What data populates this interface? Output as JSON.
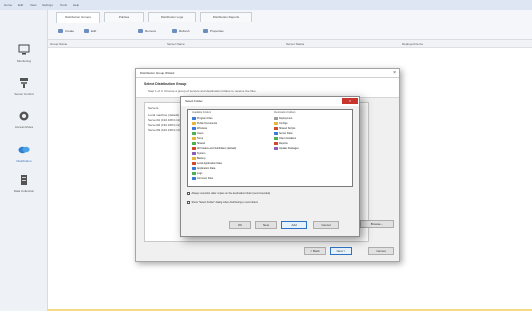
{
  "menu": [
    "Home",
    "Edit",
    "View",
    "Settings",
    "Tools",
    "Help"
  ],
  "sidebar": {
    "items": [
      {
        "label": "Monitoring",
        "icon": "monitor-icon"
      },
      {
        "label": "Server Control",
        "icon": "server-icon"
      },
      {
        "label": "Access Rules",
        "icon": "gear-icon"
      },
      {
        "label": "Distribution",
        "icon": "distribution-icon",
        "active": true
      },
      {
        "label": "Data Collection",
        "icon": "database-icon"
      }
    ]
  },
  "tabs": [
    "Distribution Groups",
    "Policies",
    "Distribution Logs",
    "Distribution Reports"
  ],
  "toolbar": [
    "Create",
    "Edit",
    "Remove",
    "Refresh",
    "Properties"
  ],
  "columns": [
    "Group Name",
    "Server Name",
    "Server Status",
    "Deployed Items"
  ],
  "wizard": {
    "title": "Distribution Group Wizard",
    "close": "×",
    "heading": "Select Distribution Group",
    "subtitle": "Step 1 of 4: Choose a group of servers and destination folders to receive the files.",
    "list_header": "Servers",
    "rows": [
      "Local machine (default)",
      "Server01 (192.168.0.11)",
      "Server02 (192.168.0.12)",
      "Server03 (192.168.0.13)"
    ],
    "buttons": {
      "side": "Browse...",
      "back": "< Back",
      "next": "Next >",
      "cancel": "Cancel"
    }
  },
  "dialog": {
    "title": "Select Folder",
    "close": "×",
    "left_header": "Available Folders",
    "right_header": "Destination Folders",
    "left_items": [
      {
        "label": "Program Files",
        "color": "#3a7bd5"
      },
      {
        "label": "Public Documents",
        "color": "#e8b339"
      },
      {
        "label": "Windows",
        "color": "#3a7bd5"
      },
      {
        "label": "Users",
        "color": "#4caf50"
      },
      {
        "label": "Temp",
        "color": "#e8b339"
      },
      {
        "label": "Shared",
        "color": "#4caf50"
      },
      {
        "label": "All Folders and Subfolders (default)",
        "color": "#d24726"
      },
      {
        "label": "System",
        "color": "#8a5fb8"
      },
      {
        "label": "Backup",
        "color": "#e8b339"
      },
      {
        "label": "Local Application Data",
        "color": "#d24726"
      },
      {
        "label": "Application Data",
        "color": "#3a7bd5"
      },
      {
        "label": "Logs",
        "color": "#4caf50"
      },
      {
        "label": "Common Files",
        "color": "#3a7bd5"
      }
    ],
    "right_items": [
      {
        "label": "Deployment",
        "color": "#9e9e9e"
      },
      {
        "label": "Configs",
        "color": "#e8b339"
      },
      {
        "label": "Shared Scripts",
        "color": "#d24726"
      },
      {
        "label": "Server Data",
        "color": "#3a7bd5"
      },
      {
        "label": "Client Installers",
        "color": "#4caf50"
      },
      {
        "label": "Reports",
        "color": "#d24726"
      },
      {
        "label": "Update Packages",
        "color": "#8a5fb8"
      }
    ],
    "options": [
      "Always overwrite older copies on the destination folder (recommended)",
      "Show \"Select Folder\" dialog when distributing to new folders"
    ],
    "buttons": {
      "ok": "OK",
      "new": "New",
      "add": "Add",
      "cancel": "Cancel"
    }
  }
}
